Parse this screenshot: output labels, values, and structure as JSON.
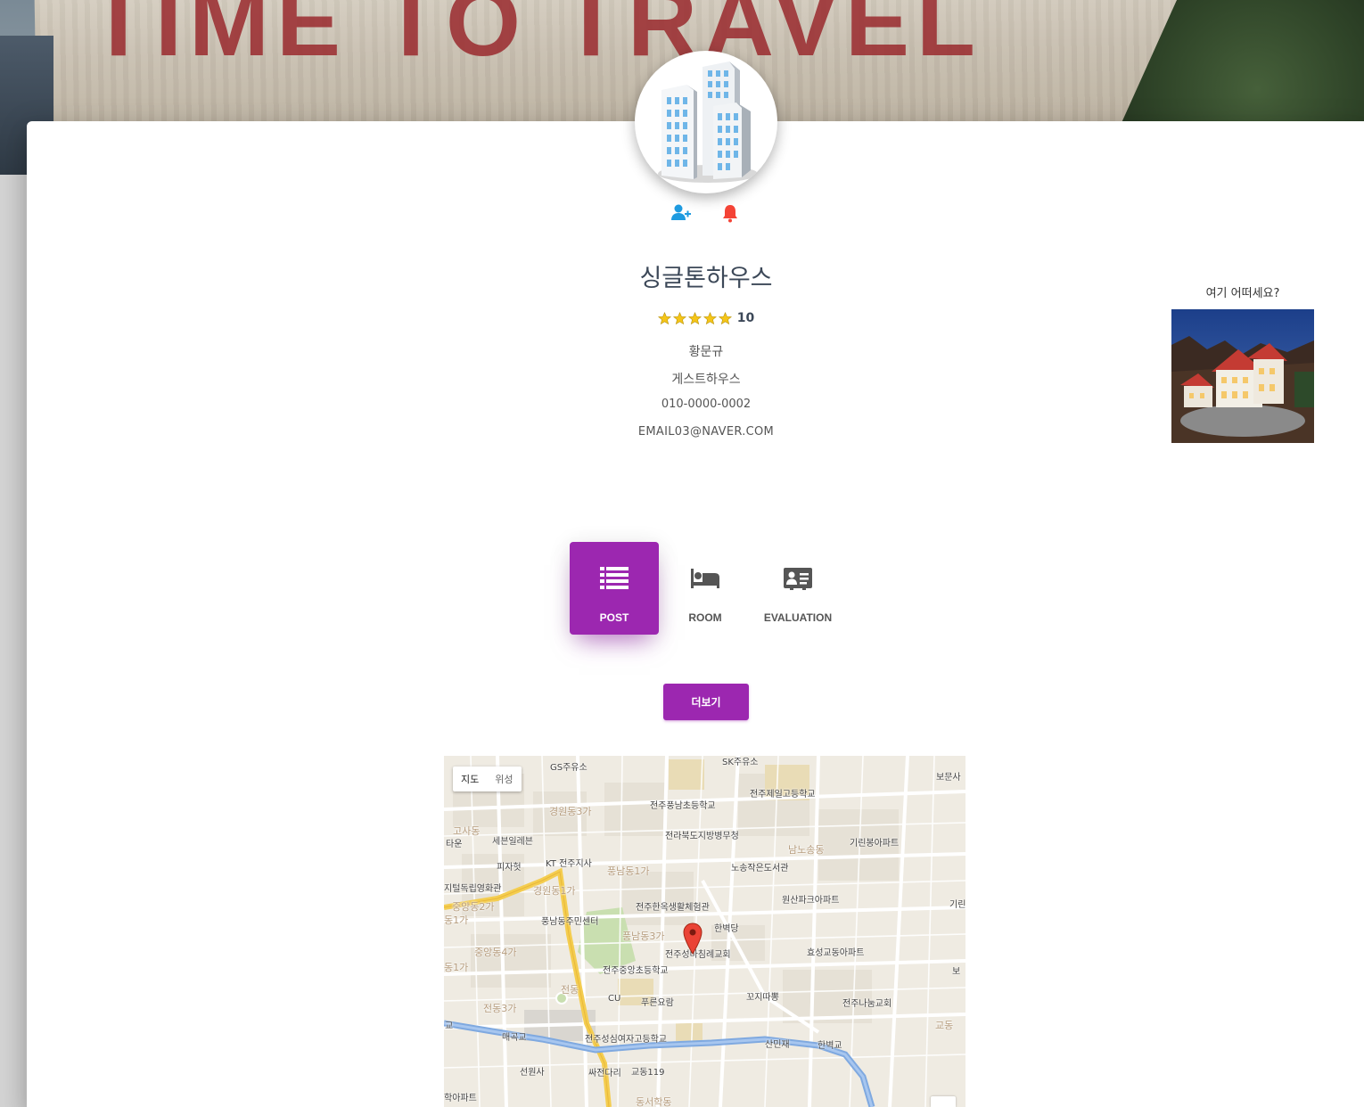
{
  "banner": {
    "sign_text": "TIME TO TRAVEL"
  },
  "profile": {
    "name": "싱글톤하우스",
    "rating": {
      "stars": 5,
      "score": "10"
    },
    "owner": "황문규",
    "type": "게스트하우스",
    "phone": "010-0000-0002",
    "email": "EMAIL03@NAVER.COM",
    "avatar_icon": "building-icon",
    "actions": [
      {
        "icon": "add-user-icon",
        "color": "#00bcd4"
      },
      {
        "icon": "bell-icon",
        "color": "#f44336"
      }
    ]
  },
  "ad": {
    "label": "여기 어떠세요?"
  },
  "tabs": [
    {
      "label": "POST",
      "icon": "list-icon",
      "active": true
    },
    {
      "label": "ROOM",
      "icon": "bed-icon",
      "active": false
    },
    {
      "label": "EVALUATION",
      "icon": "contact-card-icon",
      "active": false
    }
  ],
  "more_button": {
    "label": "더보기"
  },
  "map": {
    "toggle": {
      "map": "지도",
      "satellite": "위성"
    },
    "labels": {
      "gs": "GS주유소",
      "sk": "SK주유소",
      "bomunsa": "보문사",
      "kyungwon3": "경원동3가",
      "jeonju_pungnam_school": "전주풍남초등학교",
      "jeonju_jeil": "전주제일고등학교",
      "gosa": "고사동",
      "taun": "타운",
      "seven": "세븐일레븐",
      "fire": "전라북도지방병무청",
      "namnosong": "남노송동",
      "kirin": "기린봉아파트",
      "pizza": "피자헛",
      "kt": "KT 전주지사",
      "pungnam1": "풍남동1가",
      "nosong": "노송작은도서관",
      "digital": "지털독립영화관",
      "kyungwon1": "경원동1가",
      "wonsan": "원산파크아파트",
      "junga2": "중앙동2가",
      "pungnam_center": "풍남동주민센터",
      "hanok": "전주한옥생활체험관",
      "kirin2": "기린",
      "dong1": "동1가",
      "hanbyeok": "한벽당",
      "pungnam3": "풍남동3가",
      "junga4": "중앙동4가",
      "church": "전주성바침례교회",
      "hyoseong": "효성교동아파트",
      "dong1b": "동1가",
      "jungang_school": "전주중앙초등학교",
      "bo": "보",
      "jeondong": "전동",
      "kkoji": "꼬지따뽕",
      "cu": "CU",
      "pureun": "푸른요람",
      "naum": "전주나눔교회",
      "jeondong3": "전동3가",
      "gyodong": "교동",
      "gyo": "교",
      "maegok": "매곡교",
      "seongsim": "전주성심여자고등학교",
      "sanmin": "산민재",
      "hanbyeok_bridge": "한벽교",
      "seonwonsa": "선원사",
      "ssjeon": "싸전다리",
      "gyodong119": "교동119",
      "school_apt": "학아파트",
      "dongseo": "동서학동"
    }
  },
  "colors": {
    "accent": "#9c27b0",
    "text": "#3c4858",
    "star": "#f5c518"
  }
}
